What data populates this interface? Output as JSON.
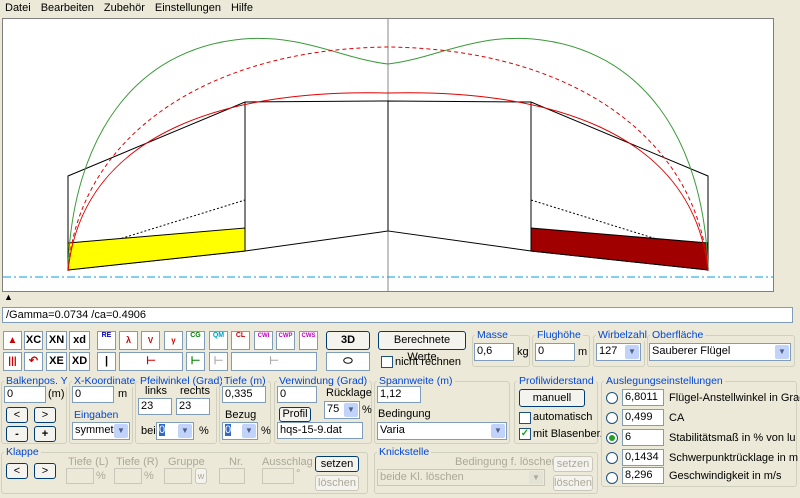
{
  "menu": [
    "Datei",
    "Bearbeiten",
    "Zubehör",
    "Einstellungen",
    "Hilfe"
  ],
  "marker": "▲",
  "status_text": "/Gamma=0.0734 /ca=0.4906",
  "toolbar": {
    "xc": "XC",
    "xn": "XN",
    "xd_lower": "xd",
    "xe": "XE",
    "xd_upper": "XD",
    "d3": "3D",
    "btn_berechnete": "Berechnete Werte",
    "nicht_rechnen": "nicht rechnen",
    "ico_labels": [
      "RE",
      "λ",
      "V",
      "γ",
      "CG",
      "QM",
      "CL",
      "CWI",
      "CWP",
      "CWS"
    ]
  },
  "masse": {
    "title": "Masse",
    "value": "0,6",
    "unit": "kg"
  },
  "flughoehe": {
    "title": "Flughöhe",
    "value": "0",
    "unit": "m"
  },
  "wirbelzahl": {
    "title": "Wirbelzahl",
    "value": "127"
  },
  "oberflaeche": {
    "title": "Oberfläche",
    "value": "Sauberer Flügel"
  },
  "balkenpos": {
    "title": "Balkenpos. Y",
    "value": "0",
    "unit": "(m)",
    "btn_left": "<",
    "btn_right": ">",
    "btn_minus": "-",
    "btn_plus": "+"
  },
  "xkoord": {
    "title": "X-Koordinate",
    "value": "0",
    "unit": "m",
    "eingaben": "Eingaben",
    "eingaben_value": "symmetr"
  },
  "pfeilwinkel": {
    "title": "Pfeilwinkel (Grad)",
    "links": "links",
    "rechts": "rechts",
    "links_value": "23",
    "rechts_value": "23",
    "bei": "bei",
    "bei_value": "0",
    "pct": "%"
  },
  "tiefe": {
    "title": "Tiefe (m)",
    "value": "0,335",
    "bezug": "Bezug",
    "bezug_value": "0",
    "pct": "%"
  },
  "verwindung": {
    "title": "Verwindung (Grad)",
    "value": "0",
    "ruecklage": "Rücklage",
    "ruecklage_value": "75",
    "pct": "%",
    "profil_btn": "Profil",
    "profil_file": "hqs-15-9.dat"
  },
  "spannweite": {
    "title": "Spannweite (m)",
    "value": "1,12",
    "bedingung": "Bedingung",
    "bedingung_value": "Varia"
  },
  "profilwiderstand": {
    "title": "Profilwiderstand",
    "btn": "manuell",
    "automatisch": "automatisch",
    "blasen": "mit Blasenber."
  },
  "auslegung": {
    "title": "Auslegungseinstellungen",
    "rows": [
      {
        "value": "6,8011",
        "label": "Flügel-Anstellwinkel in Grad",
        "selected": false
      },
      {
        "value": "0,499",
        "label": "CA",
        "selected": false
      },
      {
        "value": "6",
        "label": "Stabilitätsmaß in % von lu",
        "selected": true
      },
      {
        "value": "0,1434",
        "label": "Schwerpunktrücklage in m",
        "selected": false
      },
      {
        "value": "8,296",
        "label": "Geschwindigkeit in m/s",
        "selected": false
      }
    ]
  },
  "klappe": {
    "title": "Klappe",
    "btn_left": "<",
    "btn_right": ">",
    "tiefe_l": "Tiefe (L)",
    "tiefe_r": "Tiefe (R)",
    "gruppe": "Gruppe",
    "nr": "Nr.",
    "ausschlag": "Ausschlag",
    "pct": "%",
    "w": "w",
    "deg": "°",
    "setzen": "setzen",
    "loeschen": "löschen"
  },
  "knickstelle": {
    "title": "Knickstelle",
    "bedingung": "Bedingung f. löschen",
    "value": "beide Kl. löschen",
    "setzen": "setzen",
    "loeschen": "löschen"
  },
  "colors": {
    "flap_left": "#ffff00",
    "flap_right": "#a00000",
    "curve_green": "#3a9a3a",
    "curve_red": "#e00000",
    "axis_dashdot": "#00a0e0"
  }
}
